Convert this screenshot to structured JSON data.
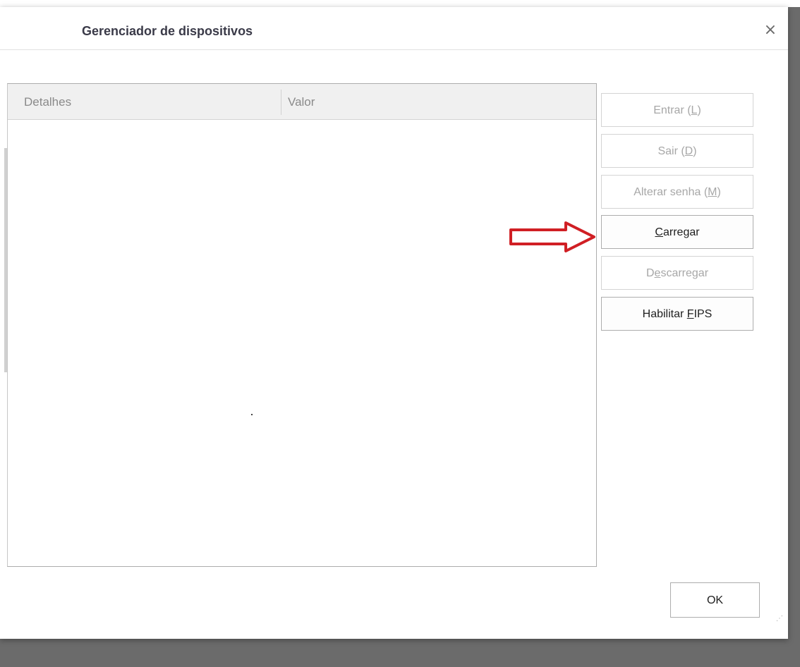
{
  "window": {
    "title": "Gerenciador de dispositivos",
    "close_icon": "×"
  },
  "table": {
    "columns": [
      "Detalhes",
      "Valor"
    ]
  },
  "buttons": {
    "login": {
      "prefix": "Entrar (",
      "mnemonic": "L",
      "suffix": ")",
      "enabled": false
    },
    "logout": {
      "prefix": "Sair (",
      "mnemonic": "D",
      "suffix": ")",
      "enabled": false
    },
    "change_password": {
      "prefix": "Alterar senha (",
      "mnemonic": "M",
      "suffix": ")",
      "enabled": false
    },
    "load": {
      "prefix": "",
      "mnemonic": "C",
      "suffix": "arregar",
      "enabled": true
    },
    "unload": {
      "prefix": "D",
      "mnemonic": "e",
      "suffix": "scarregar",
      "enabled": false
    },
    "fips": {
      "prefix": "Habilitar ",
      "mnemonic": "F",
      "suffix": "IPS",
      "enabled": true
    },
    "ok": "OK"
  },
  "annotation": {
    "arrow_color": "#d01f24",
    "arrow_icon": "arrow-right-icon"
  }
}
